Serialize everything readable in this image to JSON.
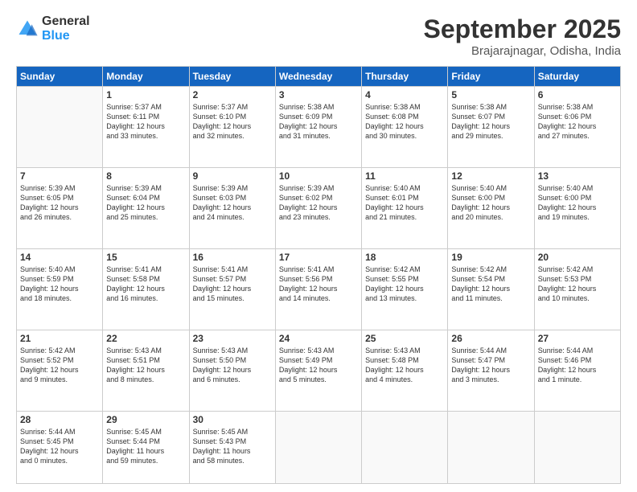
{
  "header": {
    "logo_line1": "General",
    "logo_line2": "Blue",
    "month": "September 2025",
    "location": "Brajarajnagar, Odisha, India"
  },
  "weekdays": [
    "Sunday",
    "Monday",
    "Tuesday",
    "Wednesday",
    "Thursday",
    "Friday",
    "Saturday"
  ],
  "weeks": [
    [
      {
        "day": "",
        "content": ""
      },
      {
        "day": "1",
        "content": "Sunrise: 5:37 AM\nSunset: 6:11 PM\nDaylight: 12 hours\nand 33 minutes."
      },
      {
        "day": "2",
        "content": "Sunrise: 5:37 AM\nSunset: 6:10 PM\nDaylight: 12 hours\nand 32 minutes."
      },
      {
        "day": "3",
        "content": "Sunrise: 5:38 AM\nSunset: 6:09 PM\nDaylight: 12 hours\nand 31 minutes."
      },
      {
        "day": "4",
        "content": "Sunrise: 5:38 AM\nSunset: 6:08 PM\nDaylight: 12 hours\nand 30 minutes."
      },
      {
        "day": "5",
        "content": "Sunrise: 5:38 AM\nSunset: 6:07 PM\nDaylight: 12 hours\nand 29 minutes."
      },
      {
        "day": "6",
        "content": "Sunrise: 5:38 AM\nSunset: 6:06 PM\nDaylight: 12 hours\nand 27 minutes."
      }
    ],
    [
      {
        "day": "7",
        "content": "Sunrise: 5:39 AM\nSunset: 6:05 PM\nDaylight: 12 hours\nand 26 minutes."
      },
      {
        "day": "8",
        "content": "Sunrise: 5:39 AM\nSunset: 6:04 PM\nDaylight: 12 hours\nand 25 minutes."
      },
      {
        "day": "9",
        "content": "Sunrise: 5:39 AM\nSunset: 6:03 PM\nDaylight: 12 hours\nand 24 minutes."
      },
      {
        "day": "10",
        "content": "Sunrise: 5:39 AM\nSunset: 6:02 PM\nDaylight: 12 hours\nand 23 minutes."
      },
      {
        "day": "11",
        "content": "Sunrise: 5:40 AM\nSunset: 6:01 PM\nDaylight: 12 hours\nand 21 minutes."
      },
      {
        "day": "12",
        "content": "Sunrise: 5:40 AM\nSunset: 6:00 PM\nDaylight: 12 hours\nand 20 minutes."
      },
      {
        "day": "13",
        "content": "Sunrise: 5:40 AM\nSunset: 6:00 PM\nDaylight: 12 hours\nand 19 minutes."
      }
    ],
    [
      {
        "day": "14",
        "content": "Sunrise: 5:40 AM\nSunset: 5:59 PM\nDaylight: 12 hours\nand 18 minutes."
      },
      {
        "day": "15",
        "content": "Sunrise: 5:41 AM\nSunset: 5:58 PM\nDaylight: 12 hours\nand 16 minutes."
      },
      {
        "day": "16",
        "content": "Sunrise: 5:41 AM\nSunset: 5:57 PM\nDaylight: 12 hours\nand 15 minutes."
      },
      {
        "day": "17",
        "content": "Sunrise: 5:41 AM\nSunset: 5:56 PM\nDaylight: 12 hours\nand 14 minutes."
      },
      {
        "day": "18",
        "content": "Sunrise: 5:42 AM\nSunset: 5:55 PM\nDaylight: 12 hours\nand 13 minutes."
      },
      {
        "day": "19",
        "content": "Sunrise: 5:42 AM\nSunset: 5:54 PM\nDaylight: 12 hours\nand 11 minutes."
      },
      {
        "day": "20",
        "content": "Sunrise: 5:42 AM\nSunset: 5:53 PM\nDaylight: 12 hours\nand 10 minutes."
      }
    ],
    [
      {
        "day": "21",
        "content": "Sunrise: 5:42 AM\nSunset: 5:52 PM\nDaylight: 12 hours\nand 9 minutes."
      },
      {
        "day": "22",
        "content": "Sunrise: 5:43 AM\nSunset: 5:51 PM\nDaylight: 12 hours\nand 8 minutes."
      },
      {
        "day": "23",
        "content": "Sunrise: 5:43 AM\nSunset: 5:50 PM\nDaylight: 12 hours\nand 6 minutes."
      },
      {
        "day": "24",
        "content": "Sunrise: 5:43 AM\nSunset: 5:49 PM\nDaylight: 12 hours\nand 5 minutes."
      },
      {
        "day": "25",
        "content": "Sunrise: 5:43 AM\nSunset: 5:48 PM\nDaylight: 12 hours\nand 4 minutes."
      },
      {
        "day": "26",
        "content": "Sunrise: 5:44 AM\nSunset: 5:47 PM\nDaylight: 12 hours\nand 3 minutes."
      },
      {
        "day": "27",
        "content": "Sunrise: 5:44 AM\nSunset: 5:46 PM\nDaylight: 12 hours\nand 1 minute."
      }
    ],
    [
      {
        "day": "28",
        "content": "Sunrise: 5:44 AM\nSunset: 5:45 PM\nDaylight: 12 hours\nand 0 minutes."
      },
      {
        "day": "29",
        "content": "Sunrise: 5:45 AM\nSunset: 5:44 PM\nDaylight: 11 hours\nand 59 minutes."
      },
      {
        "day": "30",
        "content": "Sunrise: 5:45 AM\nSunset: 5:43 PM\nDaylight: 11 hours\nand 58 minutes."
      },
      {
        "day": "",
        "content": ""
      },
      {
        "day": "",
        "content": ""
      },
      {
        "day": "",
        "content": ""
      },
      {
        "day": "",
        "content": ""
      }
    ]
  ]
}
